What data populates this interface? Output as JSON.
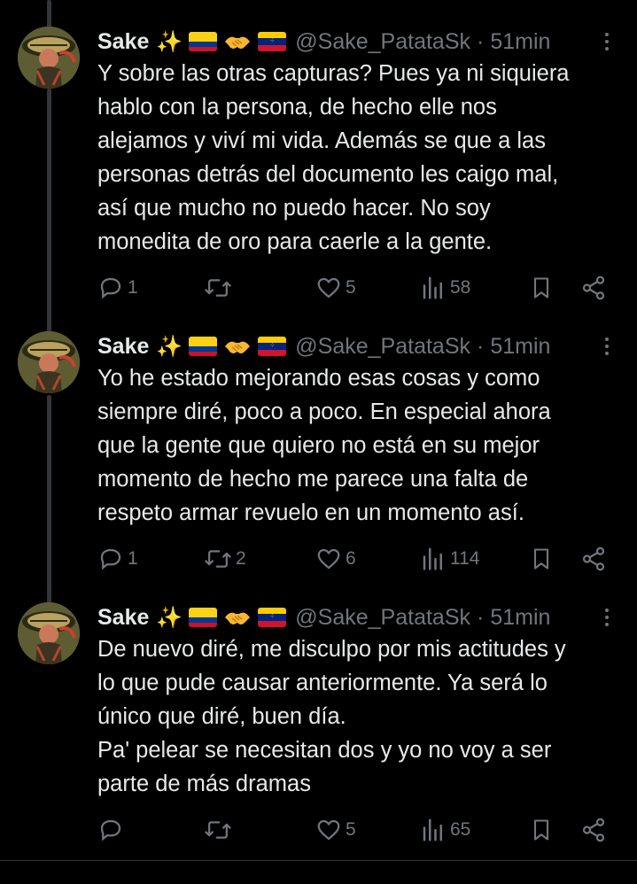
{
  "colors": {
    "background": "#000000",
    "text": "#e7e9ea",
    "muted": "#71767b",
    "thread_line": "#333639"
  },
  "tweets": [
    {
      "name": "Sake",
      "emoji": [
        "sparkles",
        "colombia-flag",
        "handshake",
        "venezuela-flag"
      ],
      "handle": "@Sake_PatataSk",
      "dot": "·",
      "time": "51min",
      "lines": [
        "Y sobre las otras capturas? Pues ya ni siquiera",
        "hablo con la persona, de hecho elle nos",
        "alejamos y viví mi vida. Además se que a las",
        "personas detrás del documento les caigo mal,",
        "así que mucho no puedo hacer. No soy",
        "monedita de oro para caerle a la gente."
      ],
      "replies": "1",
      "retweets": "",
      "likes": "5",
      "views": "58"
    },
    {
      "name": "Sake",
      "emoji": [
        "sparkles",
        "colombia-flag",
        "handshake",
        "venezuela-flag"
      ],
      "handle": "@Sake_PatataSk",
      "dot": "·",
      "time": "51min",
      "lines": [
        "Yo he estado mejorando esas cosas y como",
        "siempre diré, poco a poco. En especial ahora",
        "que la gente que quiero no está en su mejor",
        "momento de hecho me parece una falta de",
        "respeto armar revuelo en un momento así."
      ],
      "replies": "1",
      "retweets": "2",
      "likes": "6",
      "views": "114"
    },
    {
      "name": "Sake",
      "emoji": [
        "sparkles",
        "colombia-flag",
        "handshake",
        "venezuela-flag"
      ],
      "handle": "@Sake_PatataSk",
      "dot": "·",
      "time": "51min",
      "lines": [
        "De nuevo diré, me disculpo por mis actitudes y",
        "lo que pude causar anteriormente. Ya será lo",
        "único que diré, buen día.",
        "Pa' pelear se necesitan dos y yo no voy a ser",
        "parte de más dramas"
      ],
      "replies": "",
      "retweets": "",
      "likes": "5",
      "views": "65"
    }
  ]
}
